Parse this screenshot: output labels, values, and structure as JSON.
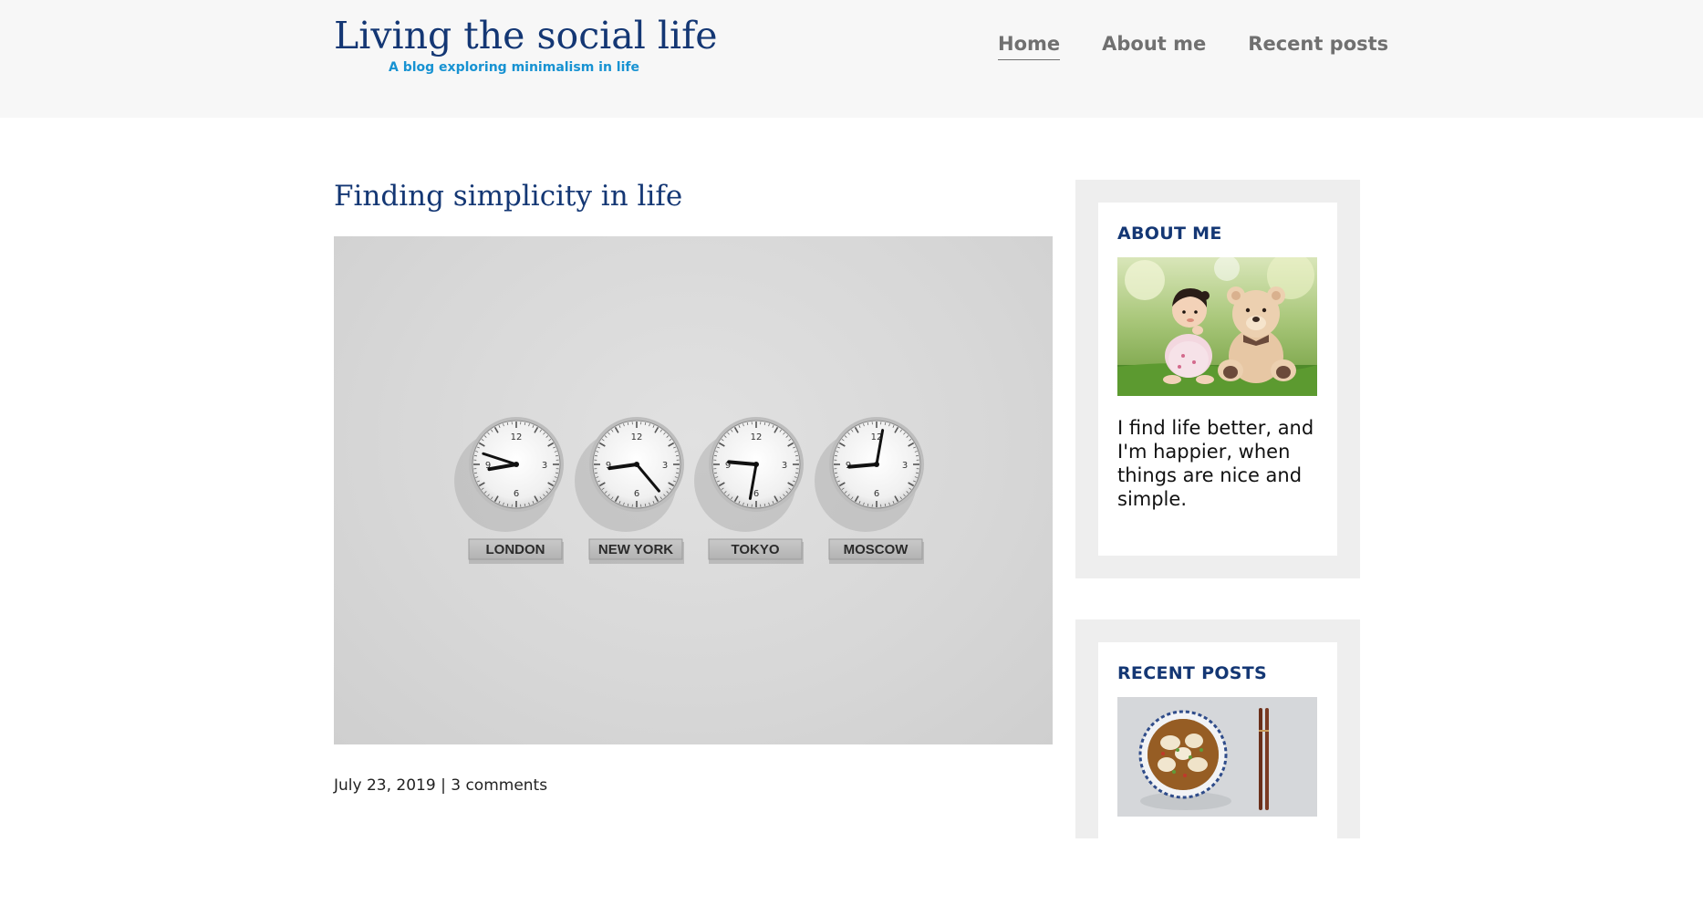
{
  "header": {
    "site_title": "Living the social life",
    "tagline": "A blog exploring minimalism in life",
    "nav": [
      {
        "label": "Home",
        "active": true
      },
      {
        "label": "About me",
        "active": false
      },
      {
        "label": "Recent posts",
        "active": false
      }
    ]
  },
  "article": {
    "title": "Finding simplicity in life",
    "image": {
      "clock_labels": [
        "LONDON",
        "NEW YORK",
        "TOKYO",
        "MOSCOW"
      ],
      "clock_numerals": [
        "12",
        "3",
        "6",
        "9"
      ]
    },
    "date": "July 23, 2019",
    "separator": "|",
    "comments": "3 comments"
  },
  "sidebar": {
    "about": {
      "title": "ABOUT ME",
      "text": "I find life better, and I'm happier, when things are nice and simple."
    },
    "recent": {
      "title": "RECENT POSTS"
    }
  },
  "colors": {
    "brand_navy": "#143774",
    "accent_blue": "#1792d2",
    "nav_gray": "#707070",
    "header_bg": "#f7f7f7",
    "panel_bg": "#eeeeee"
  }
}
